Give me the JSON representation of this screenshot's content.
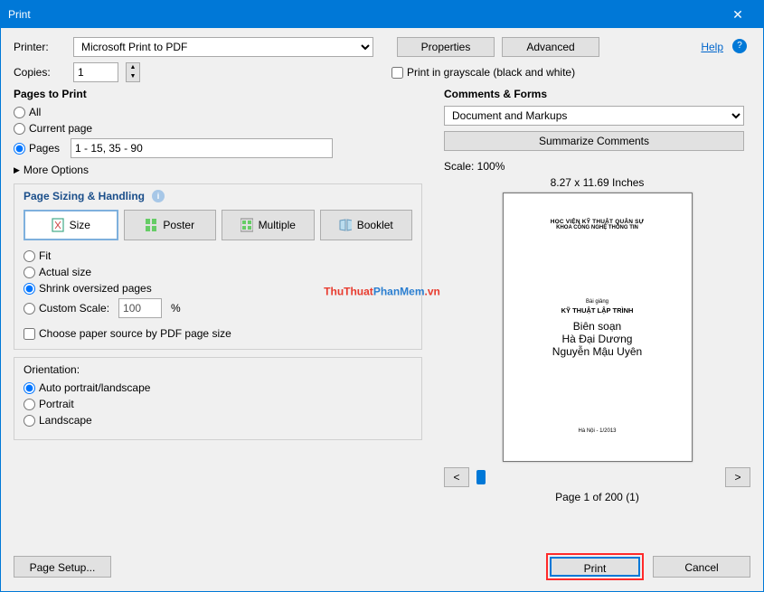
{
  "window": {
    "title": "Print"
  },
  "toolbar": {
    "printer_label": "Printer:",
    "printer_value": "Microsoft Print to PDF",
    "properties": "Properties",
    "advanced": "Advanced",
    "help": "Help",
    "copies_label": "Copies:",
    "copies_value": "1",
    "grayscale": "Print in grayscale (black and white)"
  },
  "pages_to_print": {
    "title": "Pages to Print",
    "all": "All",
    "current": "Current page",
    "pages": "Pages",
    "pages_value": "1 - 15, 35 - 90",
    "more_options": "More Options"
  },
  "sizing": {
    "title": "Page Sizing & Handling",
    "tabs": {
      "size": "Size",
      "poster": "Poster",
      "multiple": "Multiple",
      "booklet": "Booklet"
    },
    "fit": "Fit",
    "actual": "Actual size",
    "shrink": "Shrink oversized pages",
    "custom": "Custom Scale:",
    "custom_value": "100",
    "percent": "%",
    "choose_paper": "Choose paper source by PDF page size"
  },
  "orientation": {
    "title": "Orientation:",
    "auto": "Auto portrait/landscape",
    "portrait": "Portrait",
    "landscape": "Landscape"
  },
  "comments": {
    "title": "Comments & Forms",
    "select_value": "Document and Markups",
    "summarize": "Summarize Comments"
  },
  "preview": {
    "scale": "Scale: 100%",
    "dimensions": "8.27 x 11.69 Inches",
    "doc_top1": "HỌC VIỆN KỸ THUẬT QUÂN SỰ",
    "doc_top2": "KHOA CÔNG NGHỆ THÔNG TIN",
    "doc_mid1": "Bài giảng",
    "doc_mid2": "KỸ THUẬT LẬP TRÌNH",
    "doc_auth1": "Biên soạn",
    "doc_auth2": "Hà Đại Dương",
    "doc_auth3": "Nguyễn Mậu Uyên",
    "doc_foot": "Hà Nội - 1/2013",
    "nav_prev": "<",
    "nav_next": ">",
    "page_counter": "Page 1 of 200 (1)"
  },
  "footer": {
    "page_setup": "Page Setup...",
    "print": "Print",
    "cancel": "Cancel"
  },
  "watermark": {
    "a": "ThuThuat",
    "b": "PhanMem",
    "c": ".vn"
  }
}
